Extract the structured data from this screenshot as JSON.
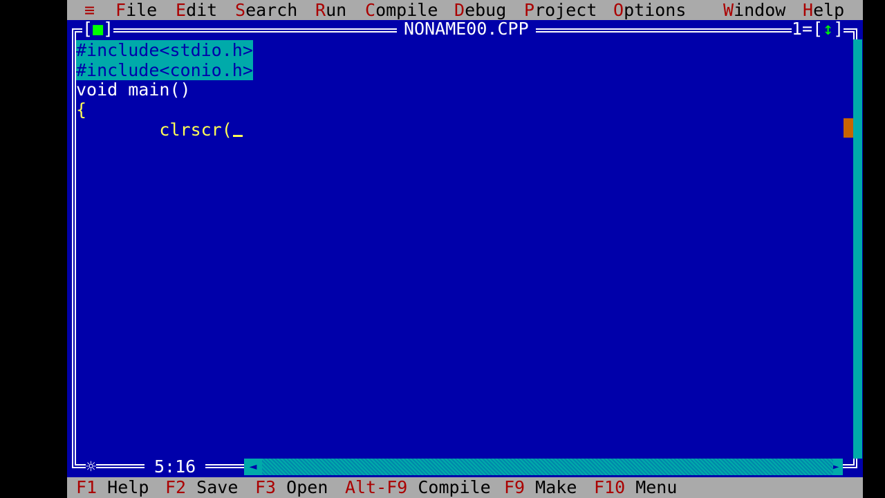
{
  "menu": {
    "system": "≡",
    "items": [
      {
        "hot": "F",
        "rest": "ile"
      },
      {
        "hot": "E",
        "rest": "dit"
      },
      {
        "hot": "S",
        "rest": "earch"
      },
      {
        "hot": "R",
        "rest": "un"
      },
      {
        "hot": "C",
        "rest": "ompile"
      },
      {
        "hot": "D",
        "rest": "ebug"
      },
      {
        "hot": "P",
        "rest": "roject"
      },
      {
        "hot": "O",
        "rest": "ptions"
      },
      {
        "hot": "W",
        "rest": "indow"
      },
      {
        "hot": "H",
        "rest": "elp"
      }
    ]
  },
  "window": {
    "title": "NONAME00.CPP",
    "close_left": "[",
    "close_box": "■",
    "close_right": "]",
    "number": "1=[",
    "zoom_arrow": "↕",
    "zoom_right": "]"
  },
  "code": {
    "line1": "#include<stdio.h>",
    "line2": "#include<conio.h>",
    "line3": "void main()",
    "line4": "{",
    "line5": "        clrscr("
  },
  "cursor_position": "5:16",
  "scroll_icons": {
    "left_arrow": "◄",
    "right_arrow": "►",
    "star": "☼"
  },
  "status": {
    "items": [
      {
        "key": "F1",
        "label": " Help"
      },
      {
        "key": "F2",
        "label": " Save"
      },
      {
        "key": "F3",
        "label": " Open"
      },
      {
        "key": "Alt-F9",
        "label": " Compile"
      },
      {
        "key": "F9",
        "label": " Make"
      },
      {
        "key": "F10",
        "label": " Menu"
      }
    ]
  },
  "colors": {
    "editor_bg": "#0000aa",
    "menu_bg": "#aaaaaa",
    "hotkey": "#aa0000",
    "selection": "#00aaaa",
    "code_text": "#ffff55"
  }
}
